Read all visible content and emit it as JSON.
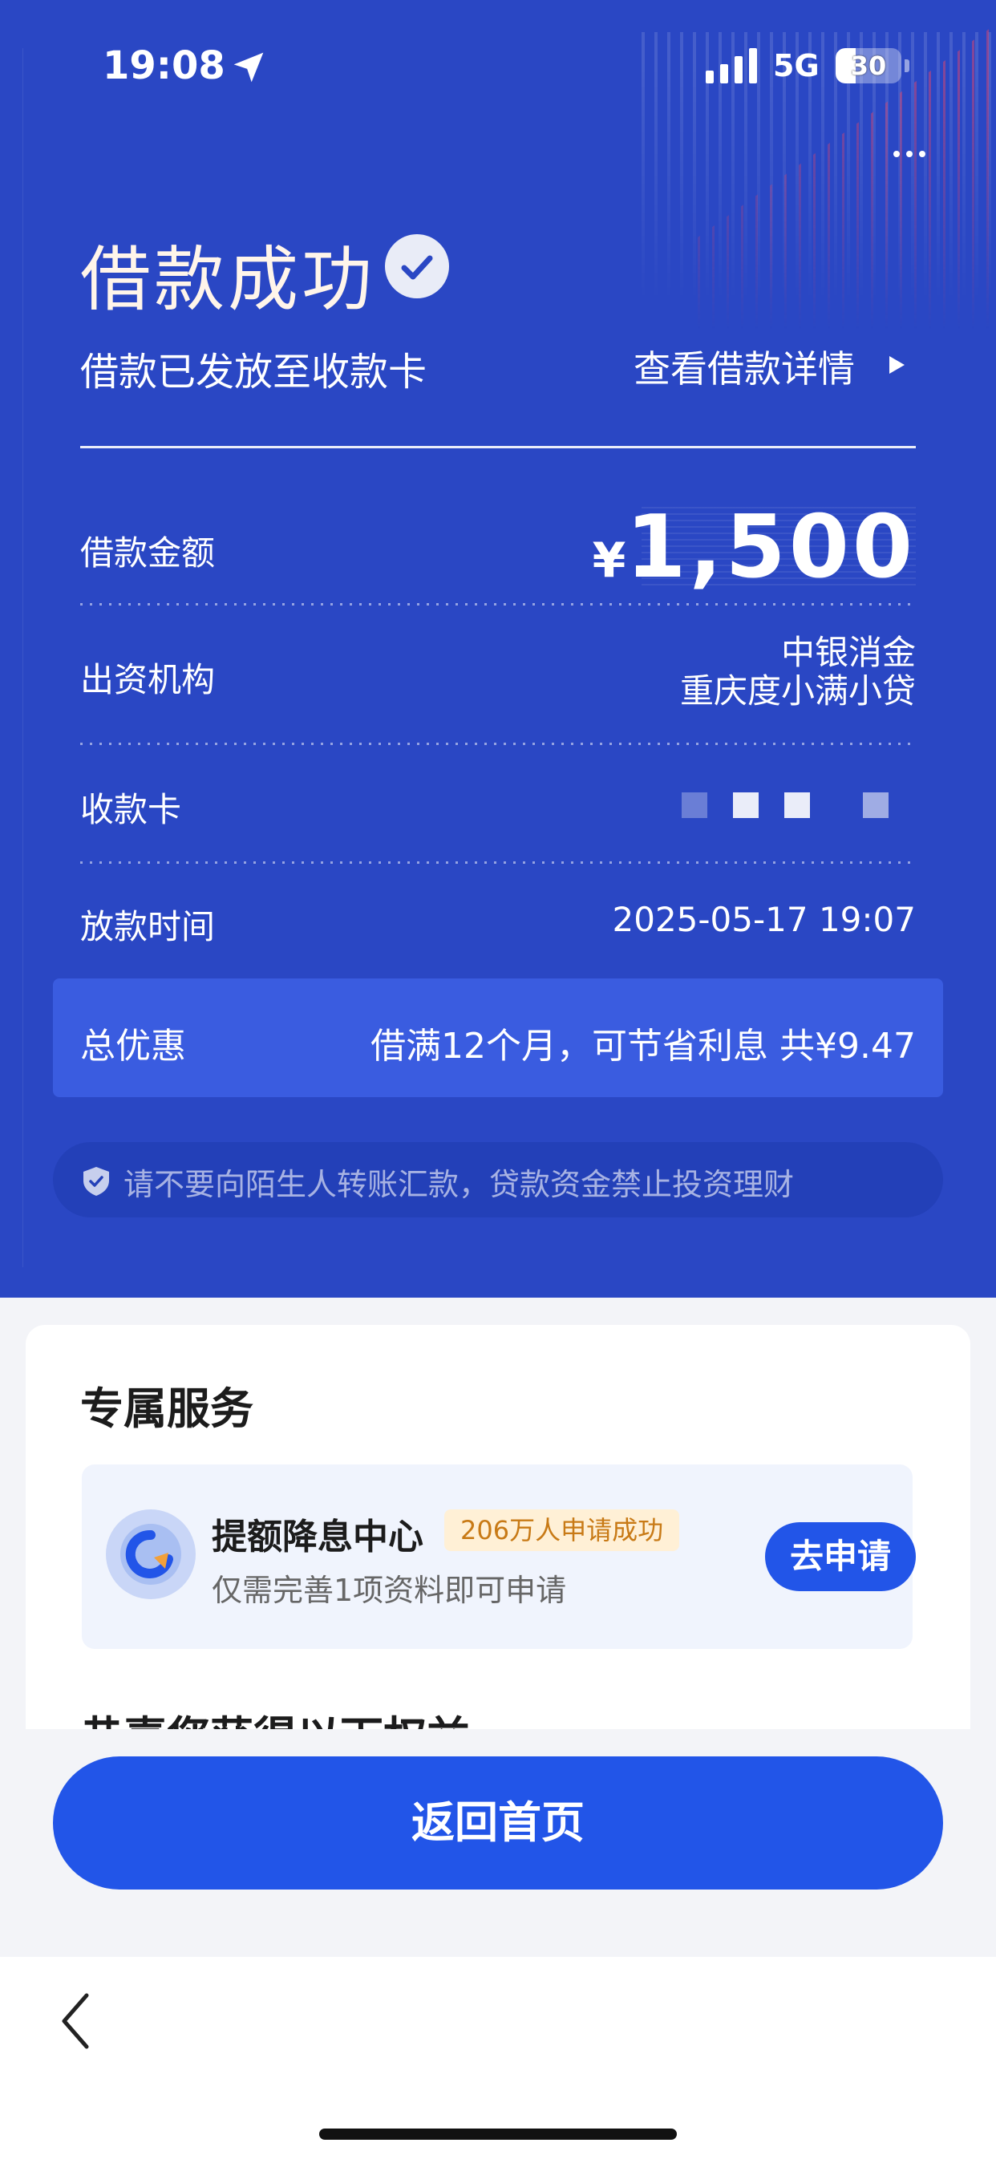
{
  "status_bar": {
    "time": "19:08",
    "network": "5G",
    "battery": "30",
    "battery_level_percent": 30
  },
  "header": {
    "title": "借款成功",
    "subtitle": "借款已发放至收款卡",
    "detail_link": "查看借款详情"
  },
  "loan": {
    "amount_label": "借款金额",
    "amount_currency": "¥",
    "amount_value": "1,500",
    "lender_label": "出资机构",
    "lender_line1": "中银消金",
    "lender_line2": "重庆度小满小贷",
    "card_label": "收款卡",
    "time_label": "放款时间",
    "time_value": "2025-05-17 19:07"
  },
  "promo": {
    "label": "总优惠",
    "value": "借满12个月，可节省利息 共¥9.47"
  },
  "warning": {
    "text": "请不要向陌生人转账汇款，贷款资金禁止投资理财"
  },
  "services": {
    "title": "专属服务",
    "item_name": "提额降息中心",
    "item_tag": "206万人申请成功",
    "item_desc": "仅需完善1项资料即可申请",
    "item_button": "去申请",
    "next_section_partial": "恭喜您获得以下权益"
  },
  "footer": {
    "home_button": "返回首页"
  },
  "colors": {
    "hero_bg": "#2a47c4",
    "primary_button": "#2255e8",
    "tag_bg": "#fff0d6",
    "tag_text": "#c87a16"
  },
  "icons": [
    "location-arrow-icon",
    "signal-icon",
    "battery-icon",
    "more-dots-icon",
    "check-badge-icon",
    "play-arrow-icon",
    "shield-icon",
    "service-logo-icon",
    "back-chevron-icon"
  ]
}
